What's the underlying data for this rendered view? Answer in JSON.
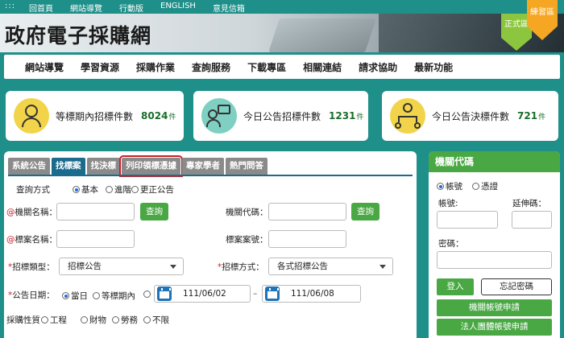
{
  "topbar": {
    "menu_glyph": ":::",
    "links": [
      "回首頁",
      "網站導覽",
      "行動版",
      "ENGLISH",
      "意見信箱"
    ]
  },
  "header": {
    "site_title": "政府電子採購網",
    "env_official": "正式區",
    "env_practice": "練習區"
  },
  "nav": {
    "items": [
      "網站導覽",
      "學習資源",
      "採購作業",
      "查詢服務",
      "下載專區",
      "相關連結",
      "請求協助",
      "最新功能"
    ]
  },
  "stats": [
    {
      "label": "等標期內招標件數",
      "value": "8024",
      "unit": "件",
      "icon": "officer-icon"
    },
    {
      "label": "今日公告招標件數",
      "value": "1231",
      "unit": "件",
      "icon": "announcement-icon"
    },
    {
      "label": "今日公告決標件數",
      "value": "721",
      "unit": "件",
      "icon": "organization-icon"
    }
  ],
  "search": {
    "tabs": [
      "系統公告",
      "找標案",
      "找決標",
      "列印領標憑據",
      "專家學者",
      "熱門問答"
    ],
    "active_tab": "找標案",
    "highlighted_tab": "列印領標憑據",
    "query_mode_label": "查詢方式",
    "query_modes": [
      "基本",
      "進階",
      "更正公告"
    ],
    "agency_name_label": "機關名稱：",
    "agency_code_label": "機關代碼：",
    "lookup_button": "查詢",
    "case_name_label": "標案名稱：",
    "case_number_label": "標案案號：",
    "tender_type_label": "招標類型：",
    "tender_type_value": "招標公告",
    "tender_method_label": "招標方式：",
    "tender_method_value": "各式招標公告",
    "announce_date_label": "公告日期：",
    "date_modes": [
      "當日",
      "等標期內"
    ],
    "date_from": "111/06/02",
    "date_to": "111/06/08",
    "procurement_nature_label": "採購性質",
    "natures": [
      "工程",
      "財物",
      "勞務",
      "不限"
    ]
  },
  "login": {
    "title": "機關代碼",
    "modes": [
      "帳號",
      "憑證"
    ],
    "account_label": "帳號:",
    "extension_label": "延伸碼：",
    "password_label": "密碼：",
    "login_button": "登入",
    "forgot_button": "忘記密碼",
    "apply_agency_button": "機關帳號申請",
    "apply_corp_button": "法人團體帳號申請"
  }
}
